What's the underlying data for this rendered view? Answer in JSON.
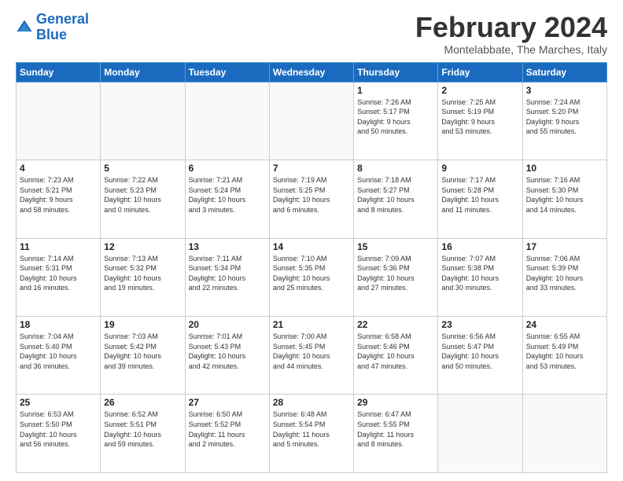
{
  "logo": {
    "line1": "General",
    "line2": "Blue"
  },
  "title": "February 2024",
  "location": "Montelabbate, The Marches, Italy",
  "days_header": [
    "Sunday",
    "Monday",
    "Tuesday",
    "Wednesday",
    "Thursday",
    "Friday",
    "Saturday"
  ],
  "weeks": [
    [
      {
        "day": "",
        "info": ""
      },
      {
        "day": "",
        "info": ""
      },
      {
        "day": "",
        "info": ""
      },
      {
        "day": "",
        "info": ""
      },
      {
        "day": "1",
        "info": "Sunrise: 7:26 AM\nSunset: 5:17 PM\nDaylight: 9 hours\nand 50 minutes."
      },
      {
        "day": "2",
        "info": "Sunrise: 7:25 AM\nSunset: 5:19 PM\nDaylight: 9 hours\nand 53 minutes."
      },
      {
        "day": "3",
        "info": "Sunrise: 7:24 AM\nSunset: 5:20 PM\nDaylight: 9 hours\nand 55 minutes."
      }
    ],
    [
      {
        "day": "4",
        "info": "Sunrise: 7:23 AM\nSunset: 5:21 PM\nDaylight: 9 hours\nand 58 minutes."
      },
      {
        "day": "5",
        "info": "Sunrise: 7:22 AM\nSunset: 5:23 PM\nDaylight: 10 hours\nand 0 minutes."
      },
      {
        "day": "6",
        "info": "Sunrise: 7:21 AM\nSunset: 5:24 PM\nDaylight: 10 hours\nand 3 minutes."
      },
      {
        "day": "7",
        "info": "Sunrise: 7:19 AM\nSunset: 5:25 PM\nDaylight: 10 hours\nand 6 minutes."
      },
      {
        "day": "8",
        "info": "Sunrise: 7:18 AM\nSunset: 5:27 PM\nDaylight: 10 hours\nand 8 minutes."
      },
      {
        "day": "9",
        "info": "Sunrise: 7:17 AM\nSunset: 5:28 PM\nDaylight: 10 hours\nand 11 minutes."
      },
      {
        "day": "10",
        "info": "Sunrise: 7:16 AM\nSunset: 5:30 PM\nDaylight: 10 hours\nand 14 minutes."
      }
    ],
    [
      {
        "day": "11",
        "info": "Sunrise: 7:14 AM\nSunset: 5:31 PM\nDaylight: 10 hours\nand 16 minutes."
      },
      {
        "day": "12",
        "info": "Sunrise: 7:13 AM\nSunset: 5:32 PM\nDaylight: 10 hours\nand 19 minutes."
      },
      {
        "day": "13",
        "info": "Sunrise: 7:11 AM\nSunset: 5:34 PM\nDaylight: 10 hours\nand 22 minutes."
      },
      {
        "day": "14",
        "info": "Sunrise: 7:10 AM\nSunset: 5:35 PM\nDaylight: 10 hours\nand 25 minutes."
      },
      {
        "day": "15",
        "info": "Sunrise: 7:09 AM\nSunset: 5:36 PM\nDaylight: 10 hours\nand 27 minutes."
      },
      {
        "day": "16",
        "info": "Sunrise: 7:07 AM\nSunset: 5:38 PM\nDaylight: 10 hours\nand 30 minutes."
      },
      {
        "day": "17",
        "info": "Sunrise: 7:06 AM\nSunset: 5:39 PM\nDaylight: 10 hours\nand 33 minutes."
      }
    ],
    [
      {
        "day": "18",
        "info": "Sunrise: 7:04 AM\nSunset: 5:40 PM\nDaylight: 10 hours\nand 36 minutes."
      },
      {
        "day": "19",
        "info": "Sunrise: 7:03 AM\nSunset: 5:42 PM\nDaylight: 10 hours\nand 39 minutes."
      },
      {
        "day": "20",
        "info": "Sunrise: 7:01 AM\nSunset: 5:43 PM\nDaylight: 10 hours\nand 42 minutes."
      },
      {
        "day": "21",
        "info": "Sunrise: 7:00 AM\nSunset: 5:45 PM\nDaylight: 10 hours\nand 44 minutes."
      },
      {
        "day": "22",
        "info": "Sunrise: 6:58 AM\nSunset: 5:46 PM\nDaylight: 10 hours\nand 47 minutes."
      },
      {
        "day": "23",
        "info": "Sunrise: 6:56 AM\nSunset: 5:47 PM\nDaylight: 10 hours\nand 50 minutes."
      },
      {
        "day": "24",
        "info": "Sunrise: 6:55 AM\nSunset: 5:49 PM\nDaylight: 10 hours\nand 53 minutes."
      }
    ],
    [
      {
        "day": "25",
        "info": "Sunrise: 6:53 AM\nSunset: 5:50 PM\nDaylight: 10 hours\nand 56 minutes."
      },
      {
        "day": "26",
        "info": "Sunrise: 6:52 AM\nSunset: 5:51 PM\nDaylight: 10 hours\nand 59 minutes."
      },
      {
        "day": "27",
        "info": "Sunrise: 6:50 AM\nSunset: 5:52 PM\nDaylight: 11 hours\nand 2 minutes."
      },
      {
        "day": "28",
        "info": "Sunrise: 6:48 AM\nSunset: 5:54 PM\nDaylight: 11 hours\nand 5 minutes."
      },
      {
        "day": "29",
        "info": "Sunrise: 6:47 AM\nSunset: 5:55 PM\nDaylight: 11 hours\nand 8 minutes."
      },
      {
        "day": "",
        "info": ""
      },
      {
        "day": "",
        "info": ""
      }
    ]
  ]
}
